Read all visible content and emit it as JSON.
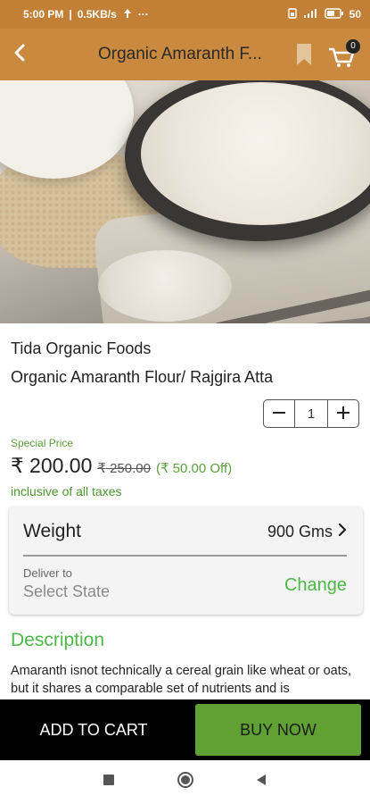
{
  "status_bar": {
    "time": "5:00 PM",
    "speed": "0.5KB/s",
    "more": "···",
    "battery": "50"
  },
  "app_bar": {
    "title": "Organic Amaranth F...",
    "cart_count": "0",
    "icons": [
      "back-arrow-icon",
      "bookmark-icon",
      "cart-icon"
    ]
  },
  "product": {
    "brand": "Tida Organic Foods",
    "name": "Organic Amaranth Flour/ Rajgira Atta",
    "quantity": "1",
    "special_label": "Special Price",
    "price": "₹ 200.00",
    "mrp": "₹ 250.00",
    "discount": "(₹ 50.00 Off)",
    "tax_note": "inclusive of all taxes"
  },
  "options": {
    "weight_label": "Weight",
    "weight_value": "900 Gms",
    "deliver_label": "Deliver to",
    "deliver_value": "Select State",
    "change_label": "Change"
  },
  "description": {
    "title": "Description",
    "text": "Amaranth isnot technically a cereal grain like wheat or oats, but it shares a comparable set of nutrients and is"
  },
  "actions": {
    "add_to_cart": "ADD TO CART",
    "buy_now": "BUY NOW"
  },
  "colors": {
    "app_bar": "#c9893e",
    "accent_green": "#4cb847",
    "buy_now_bg": "#5fa133"
  }
}
